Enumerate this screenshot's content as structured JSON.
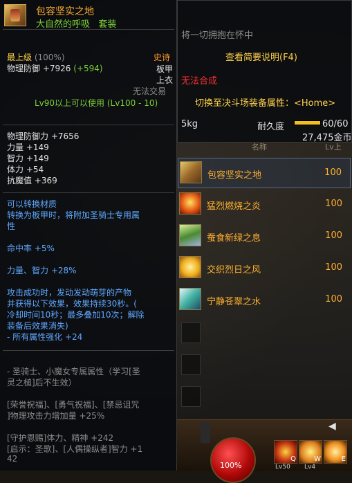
{
  "item": {
    "name": "包容坚实之地",
    "set_name": "大自然的呼吸",
    "set_tag": "套装",
    "grade": "最上级",
    "grade_pct": "(100%)",
    "rarity": "史诗",
    "armor_type": "板甲",
    "slot": "上衣",
    "trade": "无法交易",
    "phys_def_label": "物理防御",
    "phys_def_val": "+7926",
    "phys_def_bonus": "(+594)",
    "level_req": "Lv90以上可以使用 (Lv100 - 10)",
    "stats": [
      "物理防御力 +7656",
      "力量 +149",
      "智力 +149",
      "体力 +54",
      "抗魔值 +369"
    ],
    "convert_1": "可以转换材质",
    "convert_2": "转换为板甲时，将附加圣骑士专用属",
    "convert_3": "性",
    "hit": "命中率 +5%",
    "str_int": "力量、智力 +28%",
    "effect_1": "攻击成功时，发动发动萌芽的产物",
    "effect_2": "并获得以下效果，效果持续30秒。(",
    "effect_3": "冷却时间10秒；最多叠加10次；解除",
    "effect_4": "装备后效果消失)",
    "effect_5": "- 所有属性强化 +24",
    "class_1": "- 圣骑士、小魔女专属属性（学习[圣",
    "class_2": "灵之槌]后不生效）",
    "skill_1": "[荣誉祝福]、[勇气祝福]、[禁忌诅咒",
    "skill_2": "]物理攻击力增加量 +25%",
    "skill_3": "[守护恩赐]体力、精神 +242",
    "skill_4": "[启示：圣歌]、[人偶操纵者]智力 +1",
    "skill_5": "42"
  },
  "right_tip": {
    "desc": "将一切拥抱在怀中",
    "view_btn": "查看简要说明(F4)",
    "no_craft": "无法合成",
    "switch": "切换至决斗场装备属性：<Home>",
    "weight": "5kg",
    "durability_label": "耐久度",
    "durability_val": "60/60",
    "durability_fraction": 1.0,
    "price": "27,475金币"
  },
  "list": {
    "col_name": "名称",
    "col_lv": "Lv上",
    "rows": [
      {
        "name": "包容坚实之地",
        "lv": "100"
      },
      {
        "name": "猛烈燃烧之炎",
        "lv": "100"
      },
      {
        "name": "蚕食新绿之息",
        "lv": "100"
      },
      {
        "name": "交织烈日之风",
        "lv": "100"
      },
      {
        "name": "宁静苍翠之水",
        "lv": "100"
      }
    ]
  },
  "hud": {
    "hp": "100%",
    "key_q": "Q",
    "key_w": "W",
    "key_e": "E",
    "lv_q": "Lv50",
    "lv_w": "Lv4",
    "arrow": "◀"
  },
  "colors": {
    "epic": "#ffb030",
    "set_green": "#7ccf3a",
    "gold": "#ffd24a",
    "blue_text": "#5fa8ff"
  }
}
